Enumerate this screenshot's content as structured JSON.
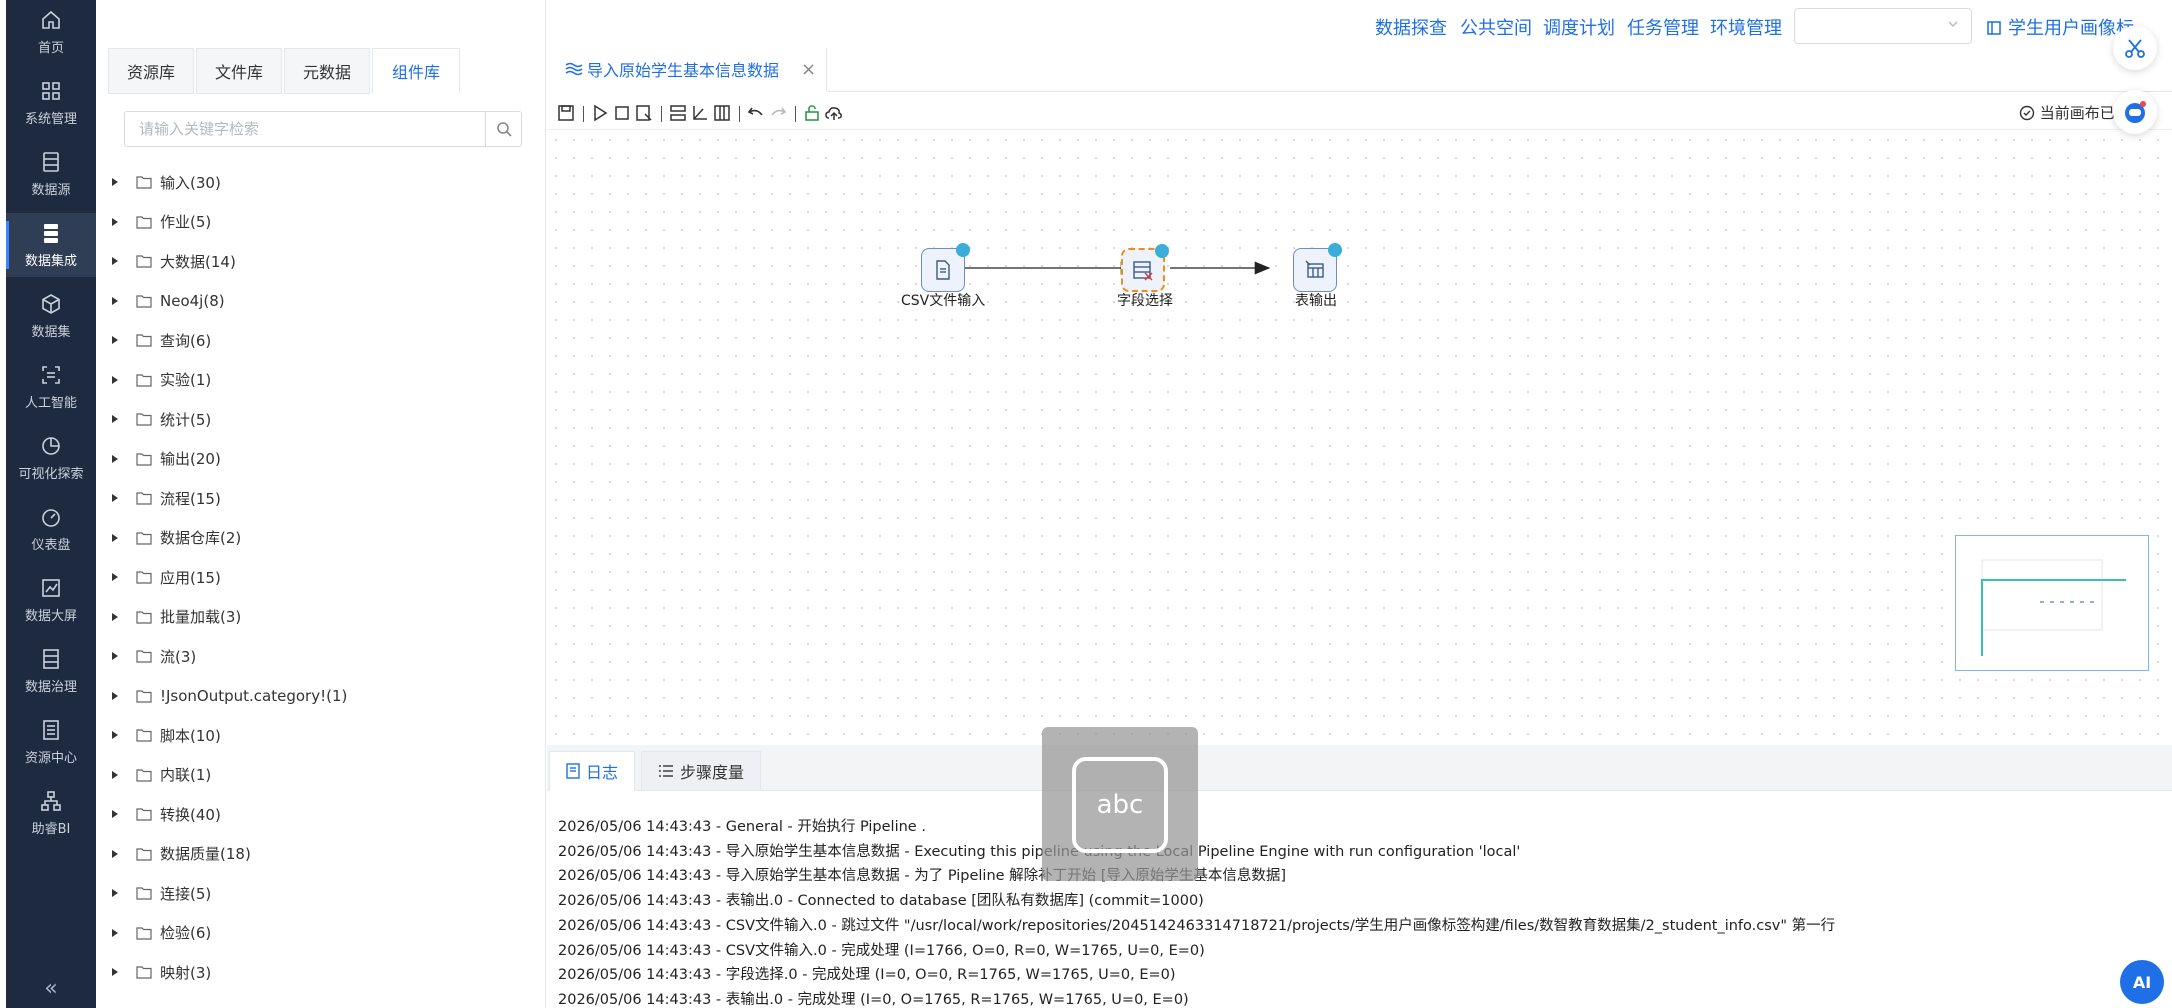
{
  "nav": {
    "items": [
      {
        "label": "首页",
        "icon": "home-icon"
      },
      {
        "label": "系统管理",
        "icon": "grid-icon"
      },
      {
        "label": "数据源",
        "icon": "database-icon"
      },
      {
        "label": "数据集成",
        "icon": "integration-icon",
        "active": true
      },
      {
        "label": "数据集",
        "icon": "cube-icon"
      },
      {
        "label": "人工智能",
        "icon": "scan-icon"
      },
      {
        "label": "可视化探索",
        "icon": "pie-chart-icon"
      },
      {
        "label": "仪表盘",
        "icon": "gauge-icon"
      },
      {
        "label": "数据大屏",
        "icon": "line-chart-icon"
      },
      {
        "label": "数据治理",
        "icon": "document-icon"
      },
      {
        "label": "资源中心",
        "icon": "folder-icon"
      },
      {
        "label": "助睿BI",
        "icon": "org-chart-icon"
      }
    ],
    "collapse": "«"
  },
  "topnav": {
    "links": [
      "数据探查",
      "公共空间",
      "调度计划",
      "任务管理",
      "环境管理"
    ],
    "select_value": "",
    "profile": "学生用户画像标"
  },
  "left_panel": {
    "tabs": [
      "资源库",
      "文件库",
      "元数据",
      "组件库"
    ],
    "active_tab": "组件库",
    "search_placeholder": "请输入关键字检索",
    "tree": [
      "输入(30)",
      "作业(5)",
      "大数据(14)",
      "Neo4j(8)",
      "查询(6)",
      "实验(1)",
      "统计(5)",
      "输出(20)",
      "流程(15)",
      "数据仓库(2)",
      "应用(15)",
      "批量加载(3)",
      "流(3)",
      "!JsonOutput.category!(1)",
      "脚本(10)",
      "内联(1)",
      "转换(40)",
      "数据质量(18)",
      "连接(5)",
      "检验(6)",
      "映射(3)"
    ]
  },
  "document_tab": {
    "title": "导入原始学生基本信息数据",
    "close": "×"
  },
  "toolbar": {
    "status": "当前画布已"
  },
  "pipeline": {
    "nodes": [
      "CSV文件输入",
      "字段选择",
      "表输出"
    ]
  },
  "log_panel": {
    "tabs": [
      "日志",
      "步骤度量"
    ],
    "lines": [
      "2026/05/06 14:43:43 - General - 开始执行 Pipeline .",
      "2026/05/06 14:43:43 - 导入原始学生基本信息数据 - Executing this pipeline using the Local Pipeline Engine with run configuration 'local'",
      "2026/05/06 14:43:43 - 导入原始学生基本信息数据 - 为了 Pipeline 解除补丁开始 [导入原始学生基本信息数据]",
      "2026/05/06 14:43:43 - 表输出.0 - Connected to database [团队私有数据库] (commit=1000)",
      "2026/05/06 14:43:43 - CSV文件输入.0 - 跳过文件 \"/usr/local/work/repositories/2045142463314718721/projects/学生用户画像标签构建/files/数智教育数据集/2_student_info.csv\" 第一行",
      "2026/05/06 14:43:43 - CSV文件输入.0 - 完成处理 (I=1766, O=0, R=0, W=1765, U=0, E=0)",
      "2026/05/06 14:43:43 - 字段选择.0 - 完成处理 (I=0, O=0, R=1765, W=1765, U=0, E=0)",
      "2026/05/06 14:43:43 - 表输出.0 - 完成处理 (I=0, O=1765, R=1765, W=1765, U=0, E=0)"
    ]
  },
  "ime": {
    "label": "abc"
  },
  "ai_button": "AI"
}
